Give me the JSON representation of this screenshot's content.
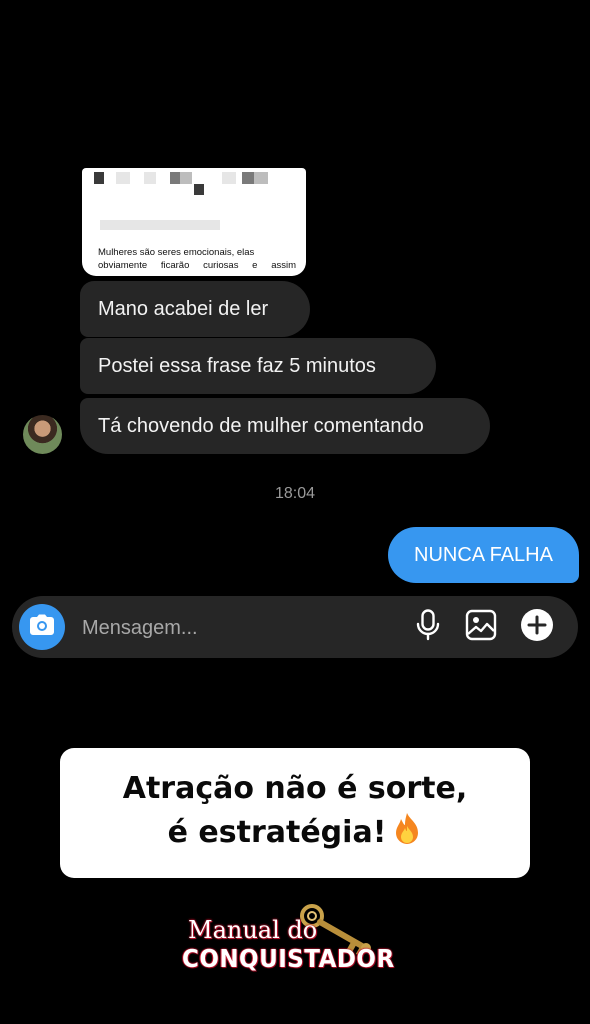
{
  "shared_post": {
    "text_line1": "Mulheres são seres emocionais, elas",
    "text_line2": "obviamente ficarão curiosas e assim"
  },
  "conversation": {
    "received": [
      {
        "text": "Mano acabei de ler"
      },
      {
        "text": "Postei essa frase faz 5 minutos"
      },
      {
        "text": "Tá chovendo de mulher comentando"
      }
    ],
    "timestamp": "18:04",
    "sent": [
      {
        "text": "NUNCA FALHA"
      }
    ]
  },
  "composer": {
    "placeholder": "Mensagem...",
    "icons": [
      "camera-icon",
      "microphone-icon",
      "gallery-icon",
      "plus-icon"
    ]
  },
  "caption": {
    "line1": "Atração não é sorte,",
    "line2": "é estratégia!",
    "emoji": "fire-icon"
  },
  "logo": {
    "line1": "Manual do",
    "line2": "CONQUISTADOR"
  },
  "colors": {
    "background": "#000000",
    "received_bubble": "#262626",
    "sent_bubble": "#3797f0",
    "composer": "#262626"
  }
}
